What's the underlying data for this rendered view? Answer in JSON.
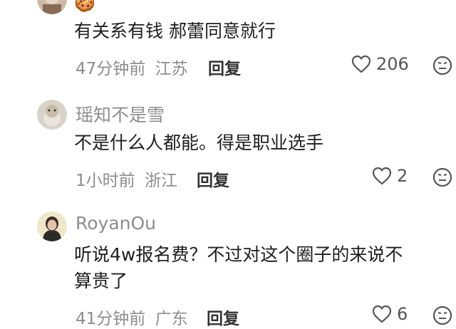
{
  "comments": [
    {
      "name": "",
      "text": "有关系有钱 郝蕾同意就行",
      "time": "47分钟前",
      "location": "江苏",
      "reply": "回复",
      "likes": "206",
      "avatar_emoji": "🍪"
    },
    {
      "name": "瑶知不是雪",
      "text": "不是什么人都能。得是职业选手",
      "time": "1小时前",
      "location": "浙江",
      "reply": "回复",
      "likes": "2"
    },
    {
      "name": "RoyanOu",
      "text_line1": "听说4w报名费？不过对这个圈子的来说不",
      "text_line2": "算贵了",
      "time": "41分钟前",
      "location": "广东",
      "reply": "回复",
      "likes": "6"
    }
  ],
  "colors": {
    "name_gray": "#8d8d8d",
    "text_dark": "#1e1e1e",
    "icon_gray": "#555555"
  }
}
